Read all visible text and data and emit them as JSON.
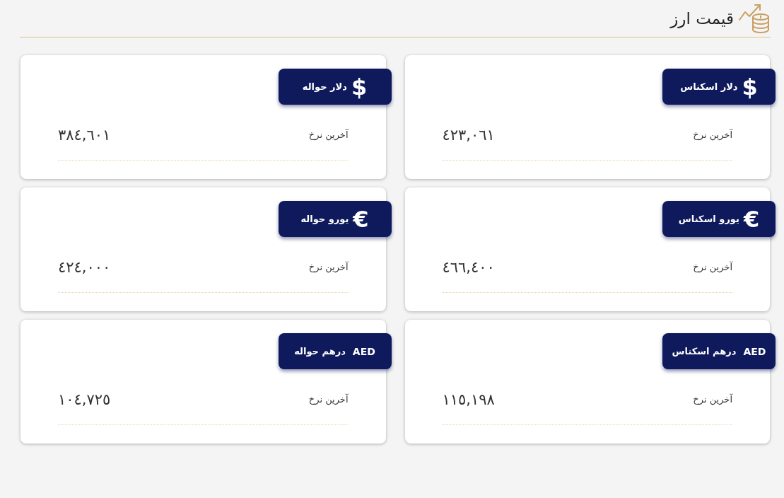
{
  "header": {
    "title": "قیمت ارز"
  },
  "cards": [
    {
      "kind": "sign",
      "symbol": "$",
      "name": "دلار اسکناس",
      "label": "آخرین نرخ",
      "value": "٤٢٣,٠٦١"
    },
    {
      "kind": "sign",
      "symbol": "$",
      "name": "دلار حواله",
      "label": "آخرین نرخ",
      "value": "٣٨٤,٦٠١"
    },
    {
      "kind": "sign",
      "symbol": "€",
      "name": "یورو اسکناس",
      "label": "آخرین نرخ",
      "value": "٤٦٦,٤٠٠"
    },
    {
      "kind": "sign",
      "symbol": "€",
      "name": "یورو حواله",
      "label": "آخرین نرخ",
      "value": "٤٢٤,٠٠٠"
    },
    {
      "kind": "code",
      "symbol": "AED",
      "name": "درهم اسکناس",
      "label": "آخرین نرخ",
      "value": "١١٥,١٩٨"
    },
    {
      "kind": "code",
      "symbol": "AED",
      "name": "درهم حواله",
      "label": "آخرین نرخ",
      "value": "١٠٤,٧٢٥"
    }
  ]
}
